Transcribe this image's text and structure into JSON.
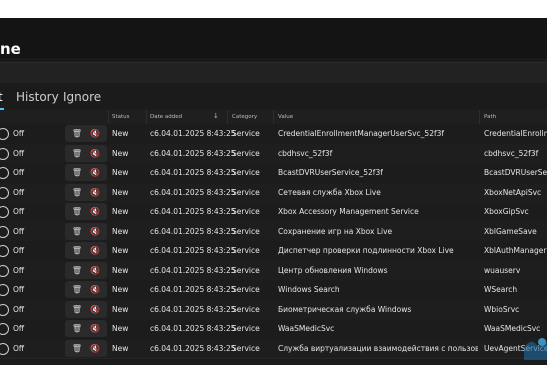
{
  "app": {
    "title": "ne"
  },
  "tabs": [
    {
      "label": "t"
    },
    {
      "label": "History"
    },
    {
      "label": "Ignore"
    }
  ],
  "columns": {
    "status": "Status",
    "date_added": "Date added",
    "category": "Category",
    "value": "Value",
    "path": "Path"
  },
  "rows": [
    {
      "toggle": "Off",
      "status": "New",
      "date": "c6.04.01.2025 8:43:25",
      "category": "Service",
      "value": "CredentialEnrollmentManagerUserSvc_52f3f",
      "path": "CredentialEnrollm"
    },
    {
      "toggle": "Off",
      "status": "New",
      "date": "c6.04.01.2025 8:43:25",
      "category": "Service",
      "value": "cbdhsvc_52f3f",
      "path": "cbdhsvc_52f3f"
    },
    {
      "toggle": "Off",
      "status": "New",
      "date": "c6.04.01.2025 8:43:25",
      "category": "Service",
      "value": "BcastDVRUserService_52f3f",
      "path": "BcastDVRUserServic"
    },
    {
      "toggle": "Off",
      "status": "New",
      "date": "c6.04.01.2025 8:43:25",
      "category": "Service",
      "value": "Сетевая служба Xbox Live",
      "path": "XboxNetApiSvc"
    },
    {
      "toggle": "Off",
      "status": "New",
      "date": "c6.04.01.2025 8:43:25",
      "category": "Service",
      "value": "Xbox Accessory Management Service",
      "path": "XboxGipSvc"
    },
    {
      "toggle": "Off",
      "status": "New",
      "date": "c6.04.01.2025 8:43:25",
      "category": "Service",
      "value": "Сохранение игр на Xbox Live",
      "path": "XblGameSave"
    },
    {
      "toggle": "Off",
      "status": "New",
      "date": "c6.04.01.2025 8:43:25",
      "category": "Service",
      "value": "Диспетчер проверки подлинности Xbox Live",
      "path": "XblAuthManager"
    },
    {
      "toggle": "Off",
      "status": "New",
      "date": "c6.04.01.2025 8:43:25",
      "category": "Service",
      "value": "Центр обновления Windows",
      "path": "wuauserv"
    },
    {
      "toggle": "Off",
      "status": "New",
      "date": "c6.04.01.2025 8:43:25",
      "category": "Service",
      "value": "Windows Search",
      "path": "WSearch"
    },
    {
      "toggle": "Off",
      "status": "New",
      "date": "c6.04.01.2025 8:43:25",
      "category": "Service",
      "value": "Биометрическая служба Windows",
      "path": "WbioSrvc"
    },
    {
      "toggle": "Off",
      "status": "New",
      "date": "c6.04.01.2025 8:43:25",
      "category": "Service",
      "value": "WaaSMedicSvc",
      "path": "WaaSMedicSvc"
    },
    {
      "toggle": "Off",
      "status": "New",
      "date": "c6.04.01.2025 8:43:25",
      "category": "Service",
      "value": "Служба виртуализации взаимодействия с пользователем",
      "path": "UevAgentService"
    }
  ],
  "icons": {
    "delete": "trash-icon",
    "mute": "mute-icon",
    "sort": "sort-down-icon"
  },
  "colors": {
    "accent": "#4cc2ff",
    "background": "#1b1b1b",
    "text": "#e6e6e6"
  }
}
